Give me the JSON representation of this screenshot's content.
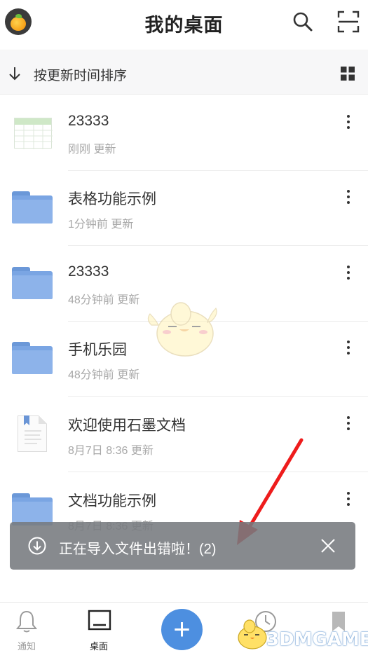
{
  "header": {
    "title": "我的桌面",
    "avatar_icon": "orange-avatar-icon",
    "search_icon": "search-icon",
    "scan_icon": "scan-icon"
  },
  "sortbar": {
    "label": "按更新时间排序",
    "arrow_icon": "arrow-down-icon",
    "view_icon": "grid-view-icon"
  },
  "files": [
    {
      "name": "23333",
      "meta": "刚刚  更新",
      "type": "spreadsheet"
    },
    {
      "name": "表格功能示例",
      "meta": "1分钟前  更新",
      "type": "folder"
    },
    {
      "name": "23333",
      "meta": "48分钟前  更新",
      "type": "folder"
    },
    {
      "name": "手机乐园",
      "meta": "48分钟前  更新",
      "type": "folder"
    },
    {
      "name": "欢迎使用石墨文档",
      "meta": "8月7日 8:36  更新",
      "type": "document"
    },
    {
      "name": "文档功能示例",
      "meta": "8月7日 8:36  更新",
      "type": "folder"
    }
  ],
  "toast": {
    "message": "正在导入文件出错啦！(2)",
    "icon": "download-circle-icon",
    "close_icon": "close-icon"
  },
  "bottom_nav": {
    "items": [
      {
        "label": "通知",
        "icon": "bell-icon"
      },
      {
        "label": "桌面",
        "icon": "desktop-icon",
        "active": true
      },
      {
        "label": "",
        "icon": "clock-icon"
      },
      {
        "label": "",
        "icon": "bookmark-icon"
      }
    ],
    "add_label": "+"
  },
  "watermark": "3DMGAME",
  "colors": {
    "accent": "#4d8fe0",
    "folder": "#7aa5e3",
    "toast_bg": "#767a7e",
    "arrow": "#ee1c1c"
  }
}
